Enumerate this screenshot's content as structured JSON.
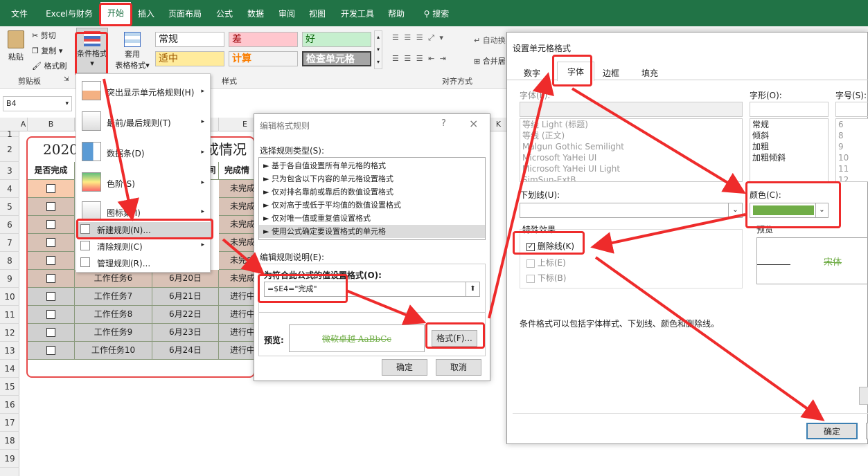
{
  "ribbon_tabs": [
    "文件",
    "Excel与财务",
    "开始",
    "插入",
    "页面布局",
    "公式",
    "数据",
    "审阅",
    "视图",
    "开发工具",
    "帮助"
  ],
  "search_label": "搜索",
  "ribbon": {
    "paste": "粘贴",
    "cut": "剪切",
    "copy": "复制",
    "format_painter": "格式刷",
    "clipboard_group": "剪贴板",
    "cond_format": "条件格式",
    "table_format_1": "套用",
    "table_format_2": "表格格式",
    "styles_group": "样式",
    "styles": [
      "常规",
      "差",
      "好",
      "适中",
      "计算",
      "检查单元格"
    ],
    "wrap_text": "自动换",
    "merge": "合并居",
    "align_group": "对齐方式"
  },
  "name_box": "B4",
  "columns": [
    "A",
    "B",
    "C",
    "D",
    "E",
    "K"
  ],
  "rows": [
    "1",
    "2",
    "3",
    "4",
    "5",
    "6",
    "7",
    "8",
    "9",
    "10",
    "11",
    "12",
    "13",
    "14",
    "15",
    "16",
    "17",
    "18",
    "19"
  ],
  "sheet": {
    "title_left": "2020",
    "title_right": "成情况",
    "header_b": "是否完成",
    "header_d": "间",
    "header_e": "完成情",
    "e_values": [
      "未完成",
      "未完成",
      "未完成",
      "未完成",
      "未完成",
      "未完成",
      "进行中",
      "进行中",
      "进行中",
      "进行中"
    ],
    "tasks": [
      {
        "name": "工作任务6",
        "date": "6月20日"
      },
      {
        "name": "工作任务7",
        "date": "6月21日"
      },
      {
        "name": "工作任务8",
        "date": "6月22日"
      },
      {
        "name": "工作任务9",
        "date": "6月23日"
      },
      {
        "name": "工作任务10",
        "date": "6月24日"
      }
    ]
  },
  "cf_menu": [
    {
      "label": "突出显示单元格规则(H)",
      "arrow": true
    },
    {
      "label": "最前/最后规则(T)",
      "arrow": true
    },
    {
      "label": "数据条(D)",
      "arrow": true
    },
    {
      "label": "色阶(S)",
      "arrow": true
    },
    {
      "label": "图标集(I)",
      "arrow": true
    },
    {
      "label": "新建规则(N)...",
      "arrow": false
    },
    {
      "label": "清除规则(C)",
      "arrow": true
    },
    {
      "label": "管理规则(R)...",
      "arrow": false
    }
  ],
  "edit_rule": {
    "title": "编辑格式规则",
    "help": "?",
    "close": "×",
    "select_type_label": "选择规则类型(S):",
    "rule_types": [
      "► 基于各自值设置所有单元格的格式",
      "► 只为包含以下内容的单元格设置格式",
      "► 仅对排名靠前或靠后的数值设置格式",
      "► 仅对高于或低于平均值的数值设置格式",
      "► 仅对唯一值或重复值设置格式",
      "► 使用公式确定要设置格式的单元格"
    ],
    "desc_label": "编辑规则说明(E):",
    "formula_label": "为符合此公式的值设置格式(O):",
    "formula": "=$E4=\"完成\"",
    "preview_label": "预览:",
    "preview_text": "微软卓越 AaBbCc",
    "format_button": "格式(F)...",
    "ok": "确定",
    "cancel": "取消"
  },
  "format_cells": {
    "title": "设置单元格格式",
    "tabs": [
      "数字",
      "字体",
      "边框",
      "填充"
    ],
    "font_label": "字体(F):",
    "style_label": "字形(O):",
    "size_label": "字号(S):",
    "fonts": [
      "等线 Light (标题)",
      "等线 (正文)",
      "Malgun Gothic Semilight",
      "Microsoft YaHei UI",
      "Microsoft YaHei UI Light",
      "SimSun-ExtB"
    ],
    "styles": [
      "常规",
      "倾斜",
      "加粗",
      "加粗倾斜"
    ],
    "sizes": [
      "6",
      "8",
      "9",
      "10",
      "11",
      "12"
    ],
    "underline_label": "下划线(U):",
    "color_label": "颜色(C):",
    "color_value": "#70ad47",
    "effects_label": "特殊效果",
    "strikethrough": "删除线(K)",
    "superscript": "上标(E)",
    "subscript": "下标(B)",
    "preview_label": "预览",
    "preview_text": "宋体",
    "note": "条件格式可以包括字体样式、下划线、颜色和删除线。",
    "ok": "确定"
  }
}
